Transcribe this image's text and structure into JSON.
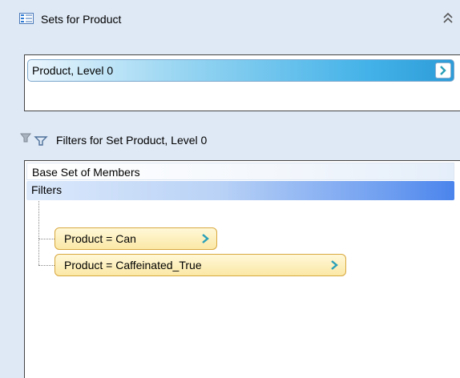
{
  "sets_panel": {
    "title": "Sets for Product",
    "icon": "list-icon",
    "collapse_icon": "double-chevron-up-icon",
    "items": [
      {
        "label": "Product, Level 0"
      }
    ]
  },
  "filters_panel": {
    "title": "Filters for Set Product, Level 0",
    "icon": "filter-icon",
    "base_set_label": "Base Set of Members",
    "filters_label": "Filters",
    "filters": [
      {
        "label": "Product = Can"
      },
      {
        "label": "Product = Caffeinated_True"
      }
    ]
  },
  "colors": {
    "background": "#dfe9f5",
    "accent_blue": "#43b2e8",
    "filter_chip": "#fbe8a6",
    "arrow": "#2aa0b8"
  }
}
